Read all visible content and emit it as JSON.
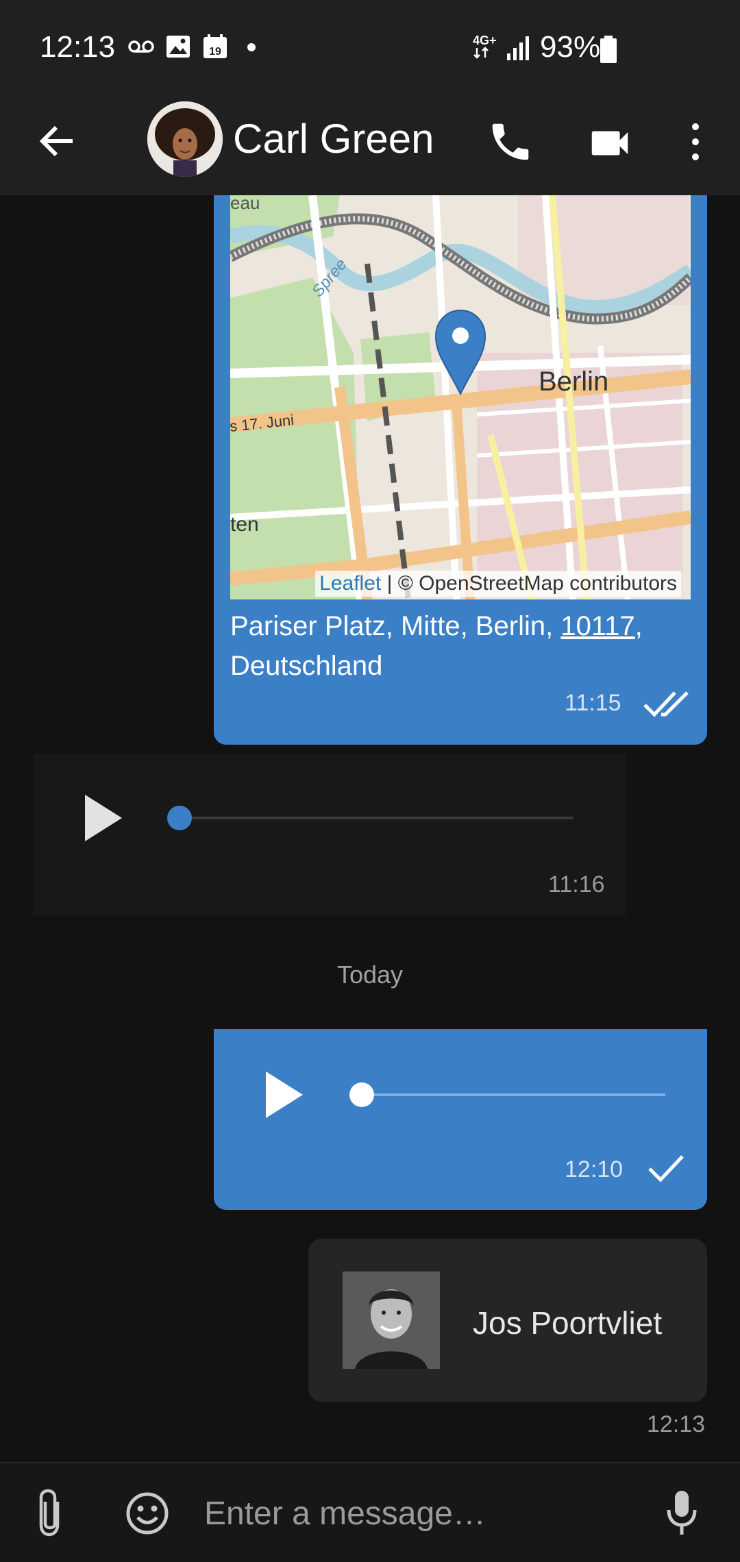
{
  "status_bar": {
    "time": "12:13",
    "network": "4G+",
    "battery": "93%",
    "calendar_day": "19"
  },
  "header": {
    "contact_name": "Carl Green",
    "icons": [
      "back-arrow",
      "phone",
      "video-camera",
      "more-vert"
    ]
  },
  "messages": {
    "location": {
      "map_label": "Berlin",
      "river_label": "Spree",
      "street_label": "s 17. Juni",
      "map_edge_labels": [
        "eau",
        "ten"
      ],
      "attribution_link": "Leaflet",
      "attribution_text": " | © OpenStreetMap contributors",
      "address_prefix": "Pariser Platz, Mitte, Berlin, ",
      "address_zip": "10117",
      "address_suffix": ", Deutschland",
      "time": "11:15",
      "status": "read"
    },
    "audio_received": {
      "time": "11:16",
      "progress": 0
    },
    "date_separator": "Today",
    "audio_sent": {
      "time": "12:10",
      "status": "sent",
      "progress": 0
    },
    "contact_card": {
      "name": "Jos Poortvliet",
      "time": "12:13"
    }
  },
  "composer": {
    "placeholder": "Enter a message…"
  },
  "colors": {
    "accent": "#3b7fc7",
    "background": "#121212",
    "bar": "#202020"
  }
}
